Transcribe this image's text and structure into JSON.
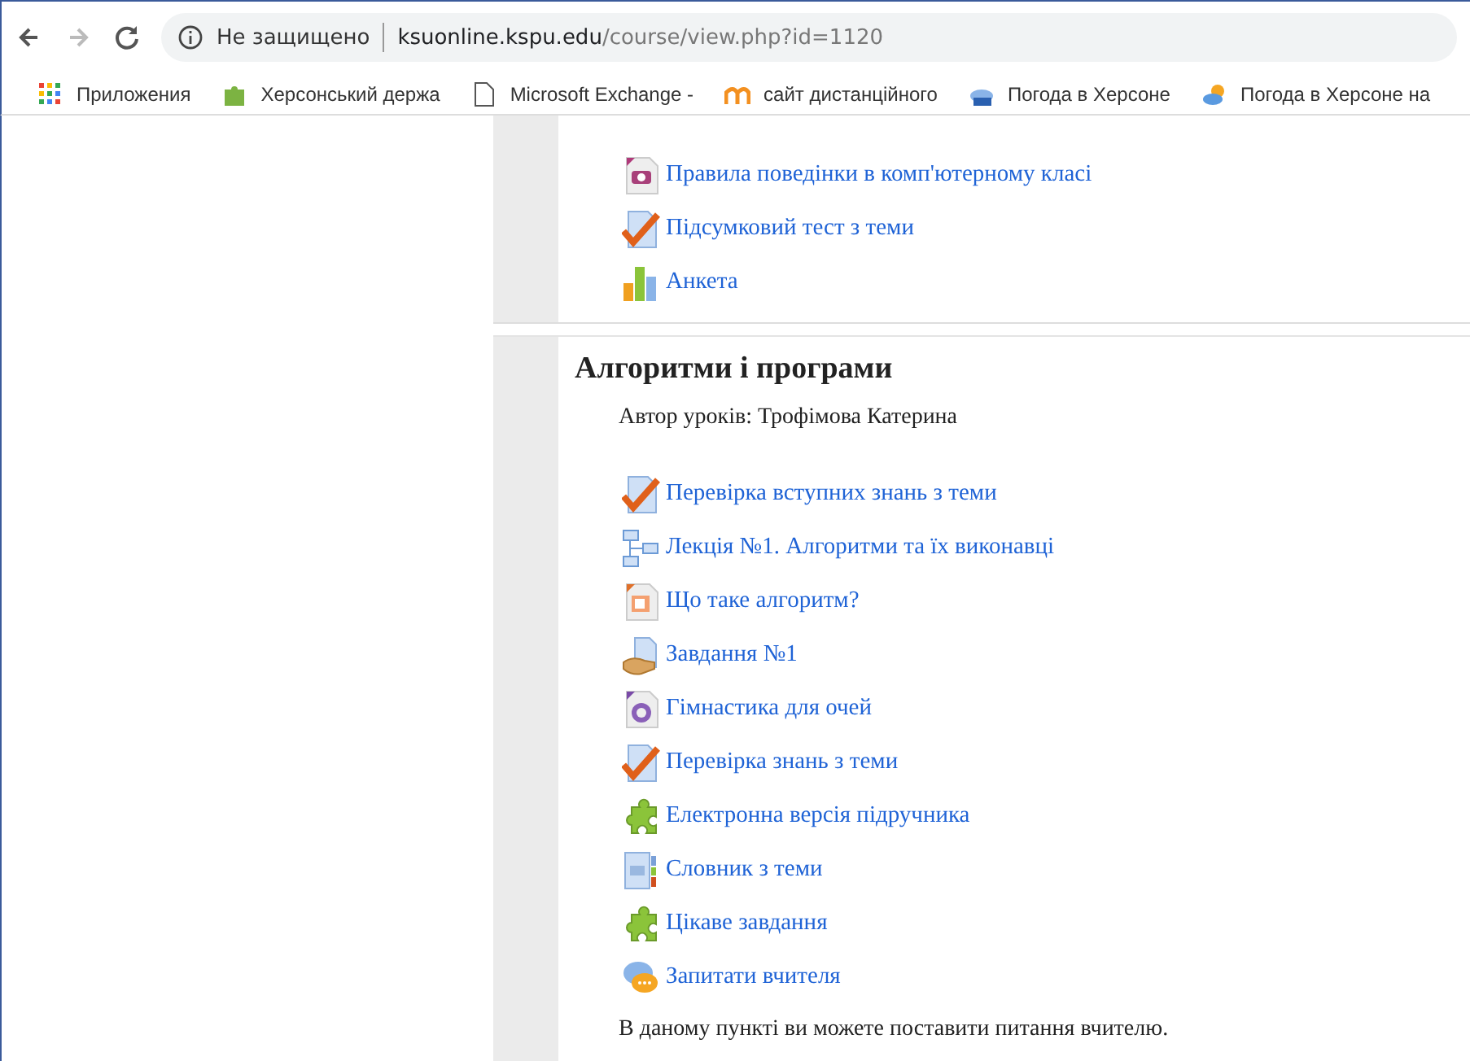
{
  "toolbar": {
    "security": "Не защищено",
    "url": {
      "host": "ksuonline.kspu.edu",
      "path": "/course/view.php?id=1120"
    }
  },
  "bookmarks": [
    {
      "kind": "apps",
      "label": "Приложения"
    },
    {
      "kind": "green",
      "label": "Херсонський держа"
    },
    {
      "kind": "page",
      "label": "Microsoft Exchange -"
    },
    {
      "kind": "moodle",
      "label": "сайт дистанційного"
    },
    {
      "kind": "weather",
      "label": "Погода в Херсоне"
    },
    {
      "kind": "sun",
      "label": "Погода в Херсоне на"
    }
  ],
  "sections": [
    {
      "items": [
        {
          "kind": "image",
          "label": "Правила поведінки в комп'ютерному класі"
        },
        {
          "kind": "quiz",
          "label": "Підсумковий тест з теми"
        },
        {
          "kind": "survey",
          "label": "Анкета"
        }
      ]
    },
    {
      "title": "Алгоритми і програми",
      "summary": "Автор уроків: Трофімова Катерина",
      "items": [
        {
          "kind": "quiz",
          "label": "Перевірка вступних знань з теми"
        },
        {
          "kind": "lesson",
          "label": "Лекція №1. Алгоритми та їх виконавці"
        },
        {
          "kind": "slides",
          "label": "Що таке алгоритм?"
        },
        {
          "kind": "assignment",
          "label": "Завдання №1"
        },
        {
          "kind": "video",
          "label": "Гімнастика для очей"
        },
        {
          "kind": "quiz",
          "label": "Перевірка знань з теми"
        },
        {
          "kind": "puzzle",
          "label": "Електронна версія підручника"
        },
        {
          "kind": "glossary",
          "label": "Словник з теми"
        },
        {
          "kind": "puzzle",
          "label": "Цікаве завдання"
        },
        {
          "kind": "chat",
          "label": "Запитати вчителя"
        }
      ],
      "footer": "В даному пункті ви можете поставити питання вчителю."
    }
  ]
}
